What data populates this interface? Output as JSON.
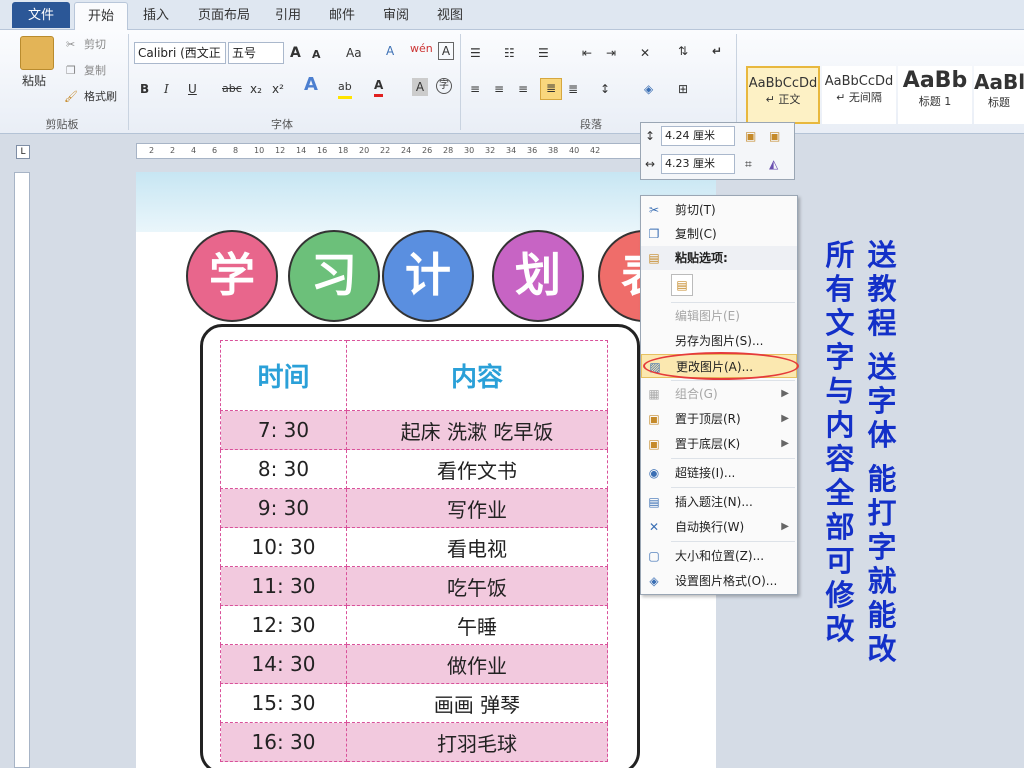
{
  "tabs": [
    "文件",
    "开始",
    "插入",
    "页面布局",
    "引用",
    "邮件",
    "审阅",
    "视图"
  ],
  "clipboard": {
    "paste": "粘贴",
    "cut": "剪切",
    "copy": "复制",
    "format_painter": "格式刷",
    "group": "剪贴板"
  },
  "font": {
    "name": "Calibri (西文正",
    "size": "五号",
    "group": "字体",
    "bold": "B",
    "italic": "I",
    "underline": "U",
    "strike": "abc",
    "sub": "x₂",
    "sup": "x²",
    "case": "Aa",
    "grow": "A",
    "shrink": "A",
    "clear": "A",
    "color_a": "A",
    "wen": "wén",
    "ab": "ab"
  },
  "paragraph": {
    "group": "段落"
  },
  "styles": [
    {
      "sample": "AaBbCcDd",
      "name": "↵ 正文"
    },
    {
      "sample": "AaBbCcDd",
      "name": "↵ 无间隔"
    },
    {
      "sample": "AaBb",
      "name": "标题 1"
    },
    {
      "sample": "AaBl",
      "name": "标题"
    }
  ],
  "ruler_marks": [
    "2",
    "2",
    "4",
    "6",
    "8",
    "10",
    "12",
    "14",
    "16",
    "18",
    "20",
    "22",
    "24",
    "26",
    "28",
    "30",
    "32",
    "34",
    "36",
    "38",
    "40",
    "42"
  ],
  "size_box": {
    "height": "4.24 厘米",
    "width": "4.23 厘米"
  },
  "context_menu": {
    "cut": "剪切(T)",
    "copy": "复制(C)",
    "paste_options": "粘贴选项:",
    "edit_picture": "编辑图片(E)",
    "save_as_picture": "另存为图片(S)...",
    "change_picture": "更改图片(A)...",
    "group": "组合(G)",
    "bring_to_front": "置于顶层(R)",
    "send_to_back": "置于底层(K)",
    "hyperlink": "超链接(I)...",
    "insert_caption": "插入题注(N)...",
    "wrap_text": "自动换行(W)",
    "size_position": "大小和位置(Z)...",
    "format_picture": "设置图片格式(O)..."
  },
  "document": {
    "title_chars": [
      "学",
      "习",
      "计",
      "划",
      "表"
    ],
    "header_time": "时间",
    "header_content": "内容",
    "rows": [
      {
        "time": "7: 30",
        "content": "起床  洗漱  吃早饭"
      },
      {
        "time": "8: 30",
        "content": "看作文书"
      },
      {
        "time": "9: 30",
        "content": "写作业"
      },
      {
        "time": "10: 30",
        "content": "看电视"
      },
      {
        "time": "11: 30",
        "content": "吃午饭"
      },
      {
        "time": "12: 30",
        "content": "午睡"
      },
      {
        "time": "14: 30",
        "content": "做作业"
      },
      {
        "time": "15: 30",
        "content": "画画   弹琴"
      },
      {
        "time": "16: 30",
        "content": "打羽毛球"
      }
    ]
  },
  "promo": {
    "line1": "送教程 送字体 能打字就能改",
    "line2": "所有文字与内容全部可修改"
  },
  "colors": {
    "accent": "#2b5797",
    "title_pink": "#e8668c",
    "title_green": "#6cc07a",
    "title_blue": "#5a8fe0",
    "title_purple": "#c764c4",
    "title_red": "#ef6d6a",
    "promo": "#1330c8"
  }
}
